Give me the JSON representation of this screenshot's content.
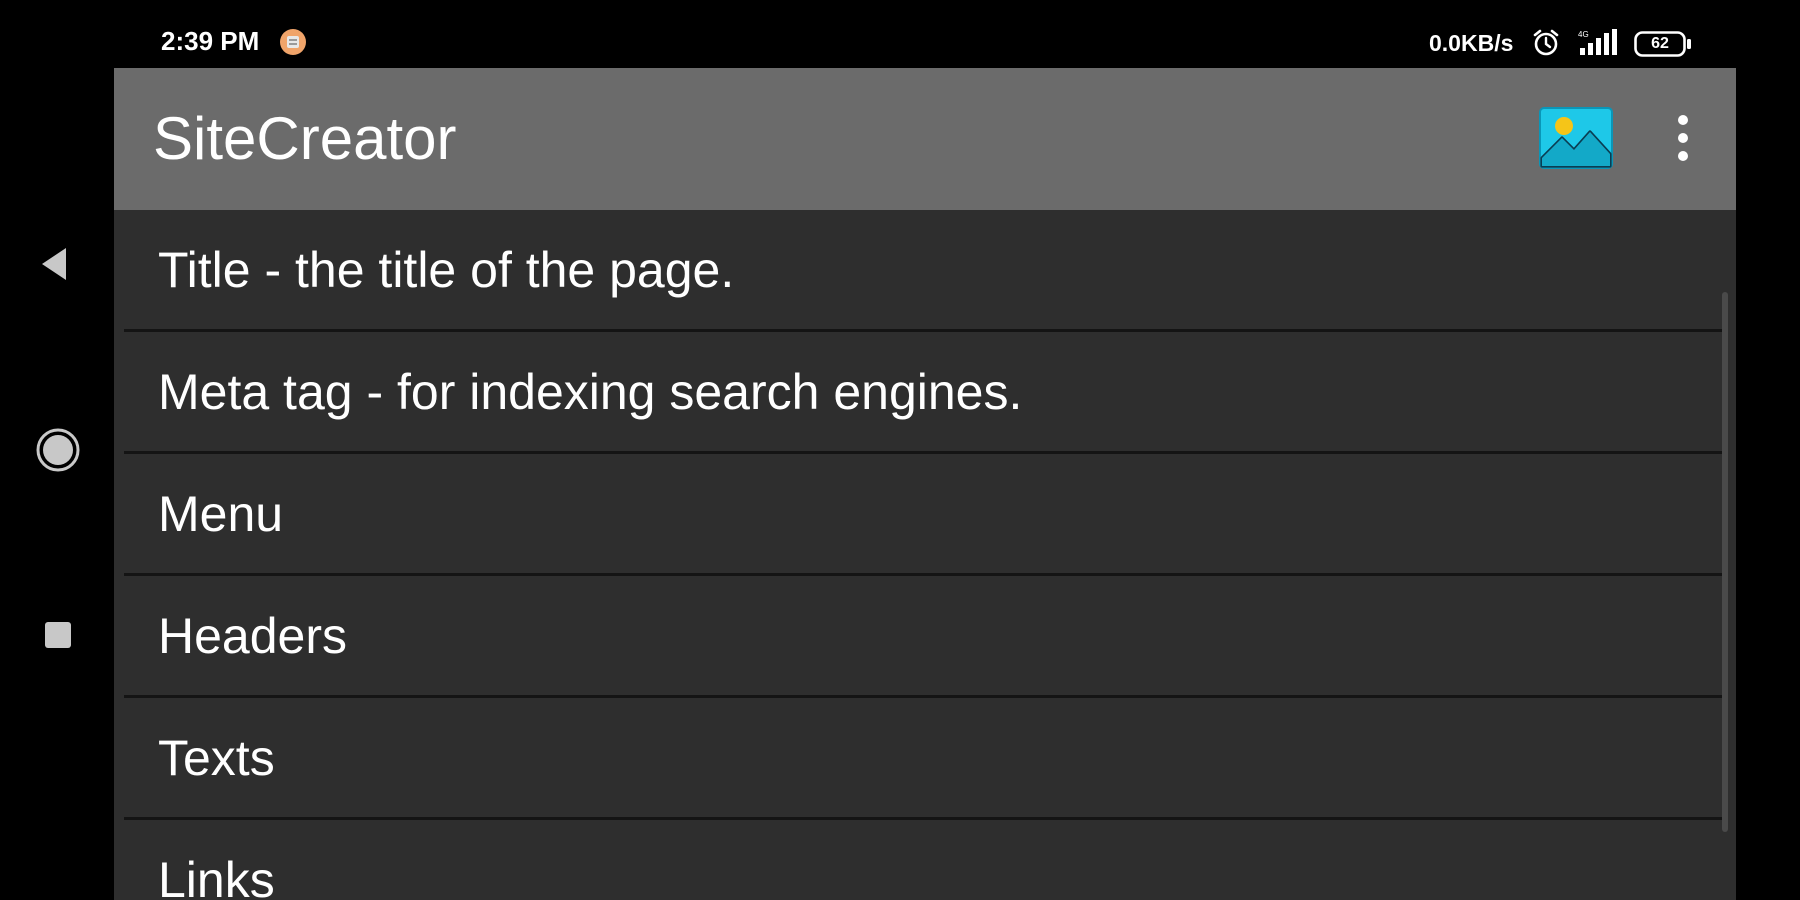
{
  "status_bar": {
    "time": "2:39 PM",
    "network_speed": "0.0KB/s",
    "battery_level": "62",
    "notification_icon": "notification-app-icon",
    "alarm_icon": "alarm-icon",
    "signal_icon": "signal-icon",
    "battery_icon": "battery-icon"
  },
  "navigation_bar": {
    "back_icon": "back-icon",
    "home_icon": "home-icon",
    "recents_icon": "recents-icon"
  },
  "toolbar": {
    "title": "SiteCreator",
    "image_icon": "image-icon",
    "overflow_icon": "more-vert-icon",
    "background_color": "#6b6b6b",
    "image_icon_colors": [
      "#1ec8e8",
      "#f5c518"
    ]
  },
  "list": {
    "items": [
      {
        "label": "Title - the title of the page."
      },
      {
        "label": "Meta tag - for indexing search engines."
      },
      {
        "label": "Menu"
      },
      {
        "label": "Headers"
      },
      {
        "label": "Texts"
      },
      {
        "label": "Links"
      }
    ],
    "background_color": "#2e2e2e",
    "divider_color": "#141414"
  }
}
